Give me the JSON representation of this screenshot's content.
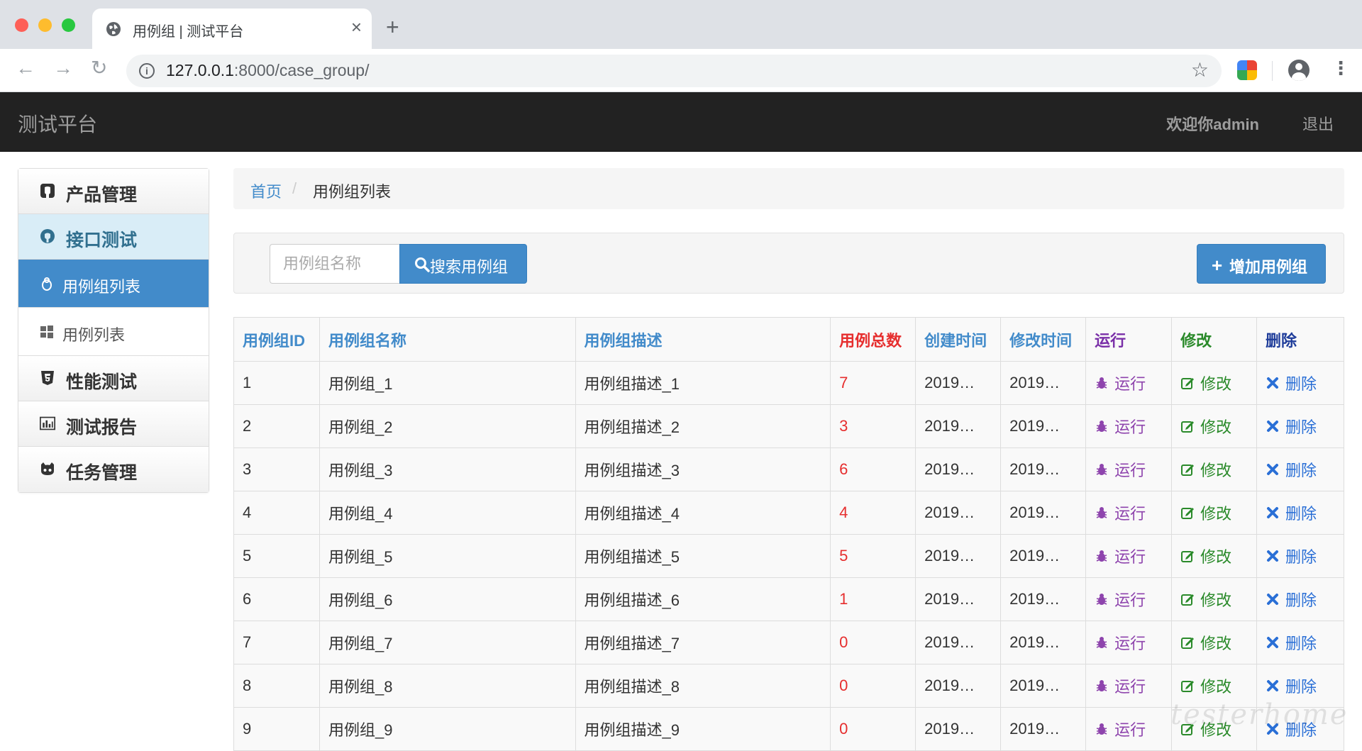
{
  "browser": {
    "tab_title": "用例组 | 测试平台",
    "tab_close": "×",
    "new_tab": "+",
    "url_host": "127.0.0.1",
    "url_rest": ":8000/case_group/",
    "nav_back": "←",
    "nav_forward": "→",
    "nav_reload": "↻",
    "bookmark_star": "☆",
    "menu": "⋮"
  },
  "navbar": {
    "brand": "测试平台",
    "welcome": "欢迎你admin",
    "logout": "退出"
  },
  "sidebar": {
    "items": [
      {
        "label": "产品管理",
        "icon": "github-icon"
      },
      {
        "label": "接口测试",
        "icon": "github-circle-icon"
      },
      {
        "label": "用例组列表",
        "icon": "linux-icon"
      },
      {
        "label": "用例列表",
        "icon": "windows-icon"
      },
      {
        "label": "性能测试",
        "icon": "html5-icon"
      },
      {
        "label": "测试报告",
        "icon": "bar-chart-icon"
      },
      {
        "label": "任务管理",
        "icon": "github-alt-icon"
      }
    ]
  },
  "breadcrumb": {
    "home": "首页",
    "separator": "/",
    "current": "用例组列表"
  },
  "search": {
    "placeholder": "用例组名称",
    "button": "搜索用例组",
    "add_button": "增加用例组",
    "add_icon": "+"
  },
  "table": {
    "headers": [
      "用例组ID",
      "用例组名称",
      "用例组描述",
      "用例总数",
      "创建时间",
      "修改时间",
      "运行",
      "修改",
      "删除"
    ],
    "action_labels": {
      "run": "运行",
      "edit": "修改",
      "delete": "删除"
    },
    "rows": [
      {
        "id": "1",
        "name": "用例组_1",
        "desc": "用例组描述_1",
        "total": "7",
        "created": "2019…",
        "modified": "2019…"
      },
      {
        "id": "2",
        "name": "用例组_2",
        "desc": "用例组描述_2",
        "total": "3",
        "created": "2019…",
        "modified": "2019…"
      },
      {
        "id": "3",
        "name": "用例组_3",
        "desc": "用例组描述_3",
        "total": "6",
        "created": "2019…",
        "modified": "2019…"
      },
      {
        "id": "4",
        "name": "用例组_4",
        "desc": "用例组描述_4",
        "total": "4",
        "created": "2019…",
        "modified": "2019…"
      },
      {
        "id": "5",
        "name": "用例组_5",
        "desc": "用例组描述_5",
        "total": "5",
        "created": "2019…",
        "modified": "2019…"
      },
      {
        "id": "6",
        "name": "用例组_6",
        "desc": "用例组描述_6",
        "total": "1",
        "created": "2019…",
        "modified": "2019…"
      },
      {
        "id": "7",
        "name": "用例组_7",
        "desc": "用例组描述_7",
        "total": "0",
        "created": "2019…",
        "modified": "2019…"
      },
      {
        "id": "8",
        "name": "用例组_8",
        "desc": "用例组描述_8",
        "total": "0",
        "created": "2019…",
        "modified": "2019…"
      },
      {
        "id": "9",
        "name": "用例组_9",
        "desc": "用例组描述_9",
        "total": "0",
        "created": "2019…",
        "modified": "2019…"
      }
    ]
  },
  "colors": {
    "primary": "#428bca",
    "navbar": "#222222",
    "count_red": "#e62e2e",
    "run_purple": "#8e44ad",
    "edit_green": "#2a8a2a",
    "delete_blue": "#2a6fd6"
  }
}
